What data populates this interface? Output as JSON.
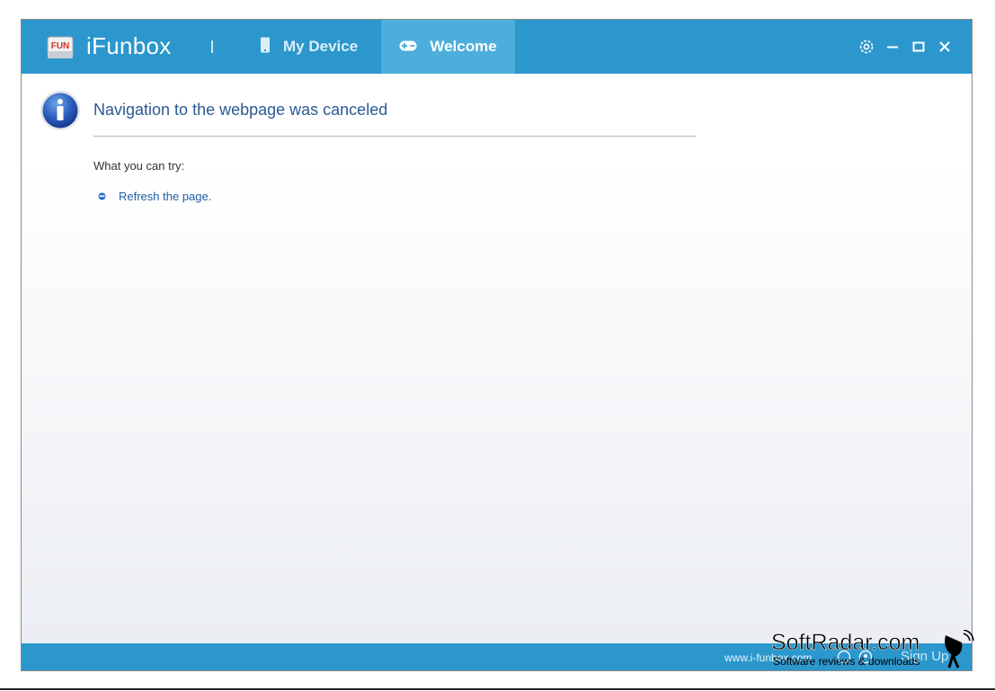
{
  "app": {
    "logo_text": "FUN",
    "name": "iFunbox"
  },
  "tabs": [
    {
      "label": "My Device",
      "icon": "phone-icon",
      "active": false
    },
    {
      "label": "Welcome",
      "icon": "gamepad-icon",
      "active": true
    }
  ],
  "window_controls": {
    "settings_icon": "gear-icon",
    "minimize_icon": "minimize-icon",
    "maximize_icon": "maximize-icon",
    "close_icon": "close-icon"
  },
  "page": {
    "heading": "Navigation to the webpage was canceled",
    "try_label": "What you can try:",
    "suggestions": [
      {
        "label": "Refresh the page."
      }
    ]
  },
  "statusbar": {
    "url": "www.i-funbox.com",
    "signup": "Sign Up"
  },
  "watermark": {
    "title": "SoftRadar.com",
    "subtitle": "Software reviews & downloads"
  },
  "colors": {
    "titlebar": "#2b97cc",
    "active_tab": "#4eaedb",
    "heading": "#2b5a94",
    "link": "#1f5fa6"
  }
}
